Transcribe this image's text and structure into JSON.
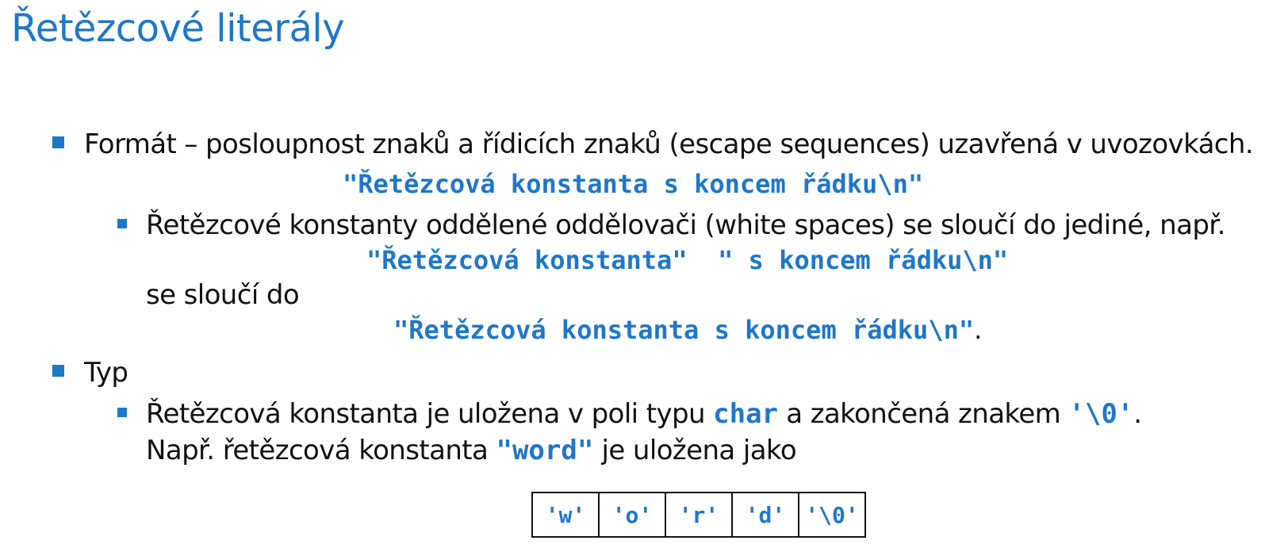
{
  "slide": {
    "title": "Řetězcové literály",
    "bullet1": {
      "text": "Formát – posloupnost znaků a řídicích znaků (escape sequences) uzavřená v uvozovkách.",
      "code": "\"Řetězcová konstanta s koncem řádku\\n\"",
      "sub": {
        "text": "Řetězcové konstanty oddělené oddělovači (white spaces) se sloučí do jediné, např.",
        "code_parts": "\"Řetězcová konstanta\"  \" s koncem řádku\\n\"",
        "merge_label": "se sloučí do",
        "code_merged": "\"Řetězcová konstanta s koncem řádku\\n\"",
        "period": "."
      }
    },
    "bullet2": {
      "text": "Typ",
      "sub": {
        "line1_a": "Řetězcová konstanta je uložena v poli typu",
        "line1_code_type": "char",
        "line1_b": "a zakončená znakem",
        "line1_code_term": "'\\0'",
        "line1_c": ".",
        "line2_a": "Např. řetězcová konstanta",
        "line2_code": "\"word\"",
        "line2_b": "je uložena jako"
      }
    },
    "char_array": [
      "'w'",
      "'o'",
      "'r'",
      "'d'",
      "'\\0'"
    ]
  },
  "colors": {
    "accent": "#1f77c8",
    "text": "#111111"
  }
}
